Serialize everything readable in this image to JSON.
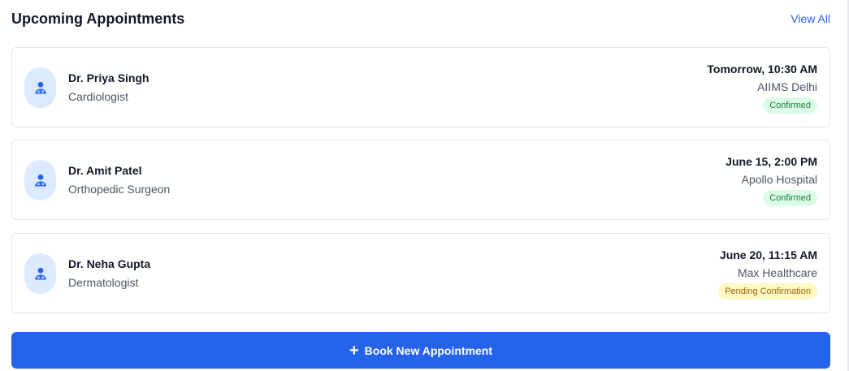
{
  "header": {
    "title": "Upcoming Appointments",
    "view_all": "View All"
  },
  "appointments": [
    {
      "doctor": "Dr. Priya Singh",
      "specialty": "Cardiologist",
      "datetime": "Tomorrow, 10:30 AM",
      "location": "AIIMS Delhi",
      "status": "Confirmed",
      "status_color": "#15803d"
    },
    {
      "doctor": "Dr. Amit Patel",
      "specialty": "Orthopedic Surgeon",
      "datetime": "June 15, 2:00 PM",
      "location": "Apollo Hospital",
      "status": "Confirmed",
      "status_color": "#15803d"
    },
    {
      "doctor": "Dr. Neha Gupta",
      "specialty": "Dermatologist",
      "datetime": "June 20, 11:15 AM",
      "location": "Max Healthcare",
      "status": "Pending Confirmation",
      "status_color": "#a16207"
    }
  ],
  "book_button": {
    "icon": "plus-icon",
    "label": "Book New Appointment"
  },
  "colors": {
    "accent": "#2563eb",
    "avatar_bg": "#dbeafe"
  },
  "icons": {
    "avatar": "doctor-icon"
  }
}
